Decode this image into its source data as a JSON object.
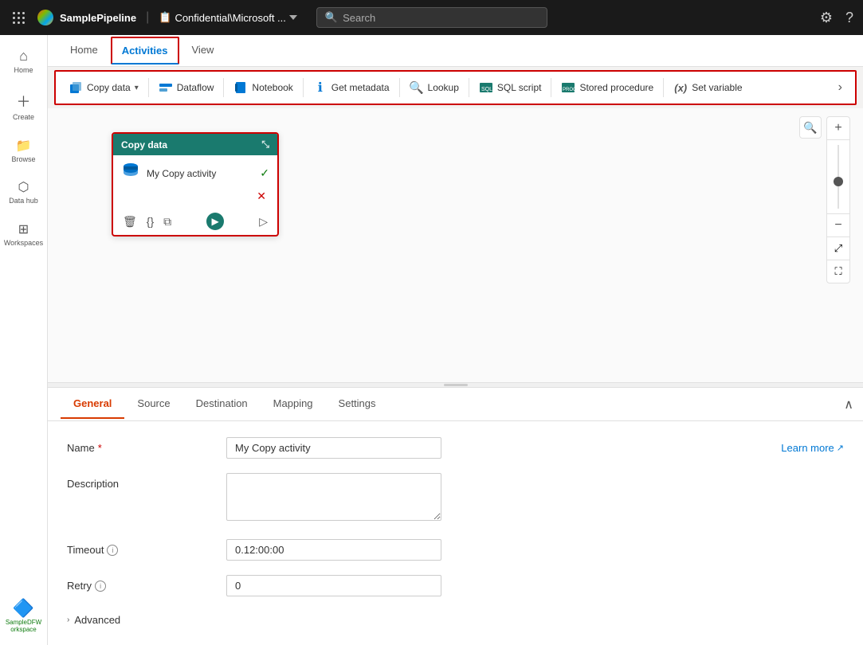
{
  "topbar": {
    "app_name": "SamplePipeline",
    "workspace": "Confidential\\Microsoft ...",
    "search_placeholder": "Search",
    "settings_label": "Settings",
    "help_label": "Help"
  },
  "sidebar": {
    "items": [
      {
        "id": "home",
        "label": "Home",
        "icon": "⌂"
      },
      {
        "id": "create",
        "label": "Create",
        "icon": "+"
      },
      {
        "id": "browse",
        "label": "Browse",
        "icon": "📁"
      },
      {
        "id": "data-hub",
        "label": "Data hub",
        "icon": "⬡"
      },
      {
        "id": "workspaces",
        "label": "Workspaces",
        "icon": "⊞"
      }
    ],
    "bottom": {
      "label": "SampleDFW orkspace",
      "icon": "🔷"
    }
  },
  "main_tabs": [
    {
      "id": "home",
      "label": "Home"
    },
    {
      "id": "activities",
      "label": "Activities",
      "active": true,
      "bordered": true
    },
    {
      "id": "view",
      "label": "View"
    }
  ],
  "activities_bar": {
    "items": [
      {
        "id": "copy-data",
        "label": "Copy data",
        "has_dropdown": true
      },
      {
        "id": "dataflow",
        "label": "Dataflow"
      },
      {
        "id": "notebook",
        "label": "Notebook"
      },
      {
        "id": "get-metadata",
        "label": "Get metadata"
      },
      {
        "id": "lookup",
        "label": "Lookup"
      },
      {
        "id": "sql-script",
        "label": "SQL script"
      },
      {
        "id": "stored-procedure",
        "label": "Stored procedure"
      },
      {
        "id": "set-variable",
        "label": "Set variable"
      }
    ],
    "more_label": "›"
  },
  "copy_node": {
    "title": "Copy data",
    "name": "My Copy activity",
    "has_check": true,
    "has_error": true
  },
  "panel_tabs": [
    {
      "id": "general",
      "label": "General",
      "active": true
    },
    {
      "id": "source",
      "label": "Source"
    },
    {
      "id": "destination",
      "label": "Destination"
    },
    {
      "id": "mapping",
      "label": "Mapping"
    },
    {
      "id": "settings",
      "label": "Settings"
    }
  ],
  "form": {
    "name_label": "Name",
    "name_required": "*",
    "name_value": "My Copy activity",
    "learn_more_label": "Learn more",
    "description_label": "Description",
    "description_value": "",
    "description_placeholder": "",
    "timeout_label": "Timeout",
    "timeout_value": "0.12:00:00",
    "retry_label": "Retry",
    "retry_value": "0",
    "advanced_label": "Advanced"
  },
  "zoom": {
    "plus": "+",
    "minus": "−"
  }
}
